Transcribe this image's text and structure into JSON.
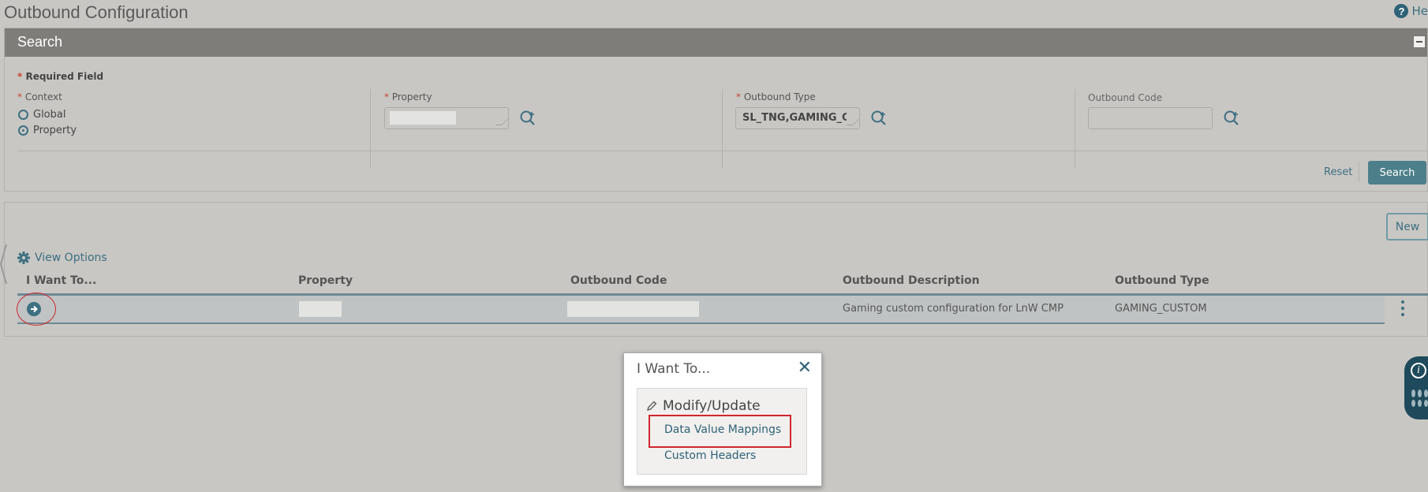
{
  "page": {
    "title": "Outbound Configuration",
    "help_label": "He"
  },
  "search": {
    "header": "Search",
    "required_note": "Required Field",
    "context": {
      "label": "Context",
      "options": [
        "Global",
        "Property"
      ],
      "selected": "Property"
    },
    "property": {
      "label": "Property",
      "value": ""
    },
    "outbound_type": {
      "label": "Outbound Type",
      "value": "SL_TNG,GAMING_C"
    },
    "outbound_code": {
      "label": "Outbound Code",
      "value": ""
    },
    "reset_label": "Reset",
    "search_label": "Search"
  },
  "results": {
    "new_label": "New",
    "view_options_label": "View Options",
    "columns": [
      "I Want To...",
      "Property",
      "Outbound Code",
      "Outbound Description",
      "Outbound Type"
    ],
    "rows": [
      {
        "property": "",
        "outbound_code": "",
        "description": "Gaming custom configuration for LnW CMP",
        "type": "GAMING_CUSTOM"
      }
    ]
  },
  "popup": {
    "title": "I Want To...",
    "section": "Modify/Update",
    "links": [
      "Data Value Mappings",
      "Custom Headers"
    ]
  },
  "colors": {
    "accent": "#3d6f80",
    "header_bg": "#7f7d7a",
    "highlight": "#d1262f"
  }
}
